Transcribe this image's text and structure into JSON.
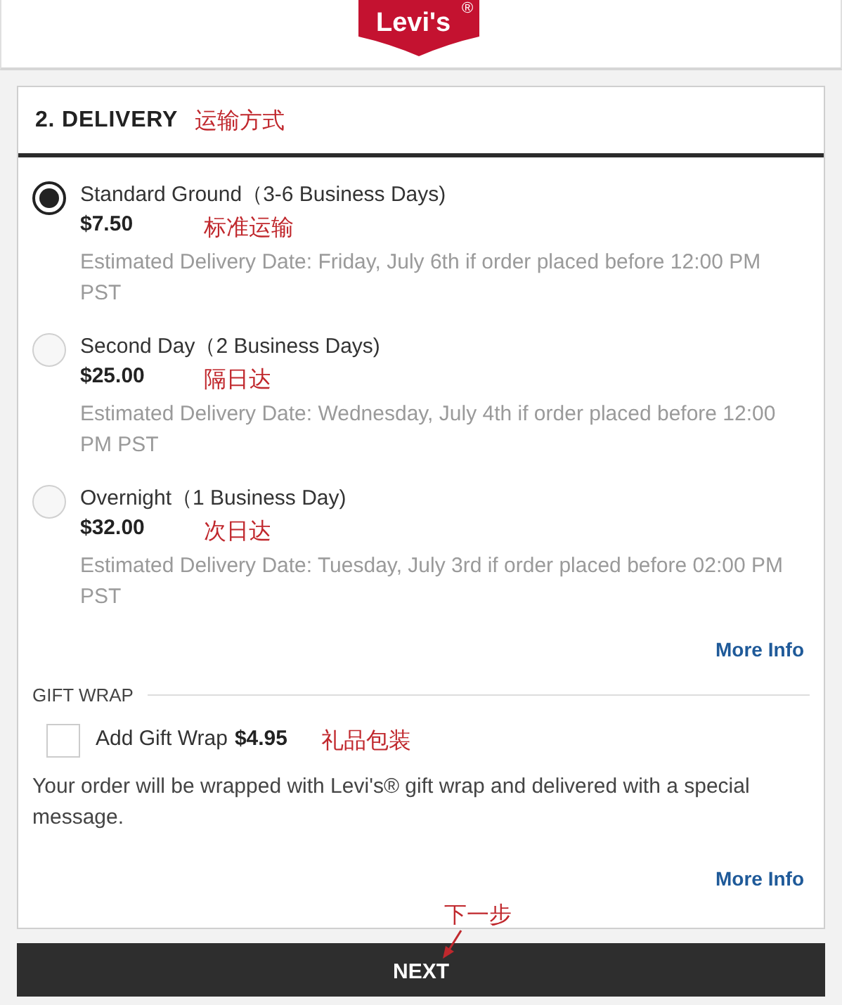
{
  "logo": {
    "text": "Levi's",
    "mark": "®"
  },
  "section": {
    "title": "2. DELIVERY",
    "annotation": "运输方式"
  },
  "shipping_options": [
    {
      "name": "Standard Ground（3-6 Business Days)",
      "price": "$7.50",
      "annotation": "标准运输",
      "estimate": "Estimated Delivery Date: Friday, July 6th if order placed before 12:00 PM PST",
      "selected": true
    },
    {
      "name": "Second Day（2 Business Days)",
      "price": "$25.00",
      "annotation": "隔日达",
      "estimate": "Estimated Delivery Date: Wednesday, July 4th if order placed before 12:00 PM PST",
      "selected": false
    },
    {
      "name": "Overnight（1 Business Day)",
      "price": "$32.00",
      "annotation": "次日达",
      "estimate": "Estimated Delivery Date: Tuesday, July 3rd if order placed before 02:00 PM PST",
      "selected": false
    }
  ],
  "shipping_more_info": "More Info",
  "gift_wrap": {
    "heading": "GIFT WRAP",
    "label": "Add Gift Wrap",
    "price": "$4.95",
    "checked": false,
    "annotation": "礼品包装",
    "description": "Your order will be wrapped with Levi's® gift wrap and delivered with a special message.",
    "more_info": "More Info"
  },
  "next_button": {
    "label": "NEXT",
    "annotation": "下一步"
  }
}
